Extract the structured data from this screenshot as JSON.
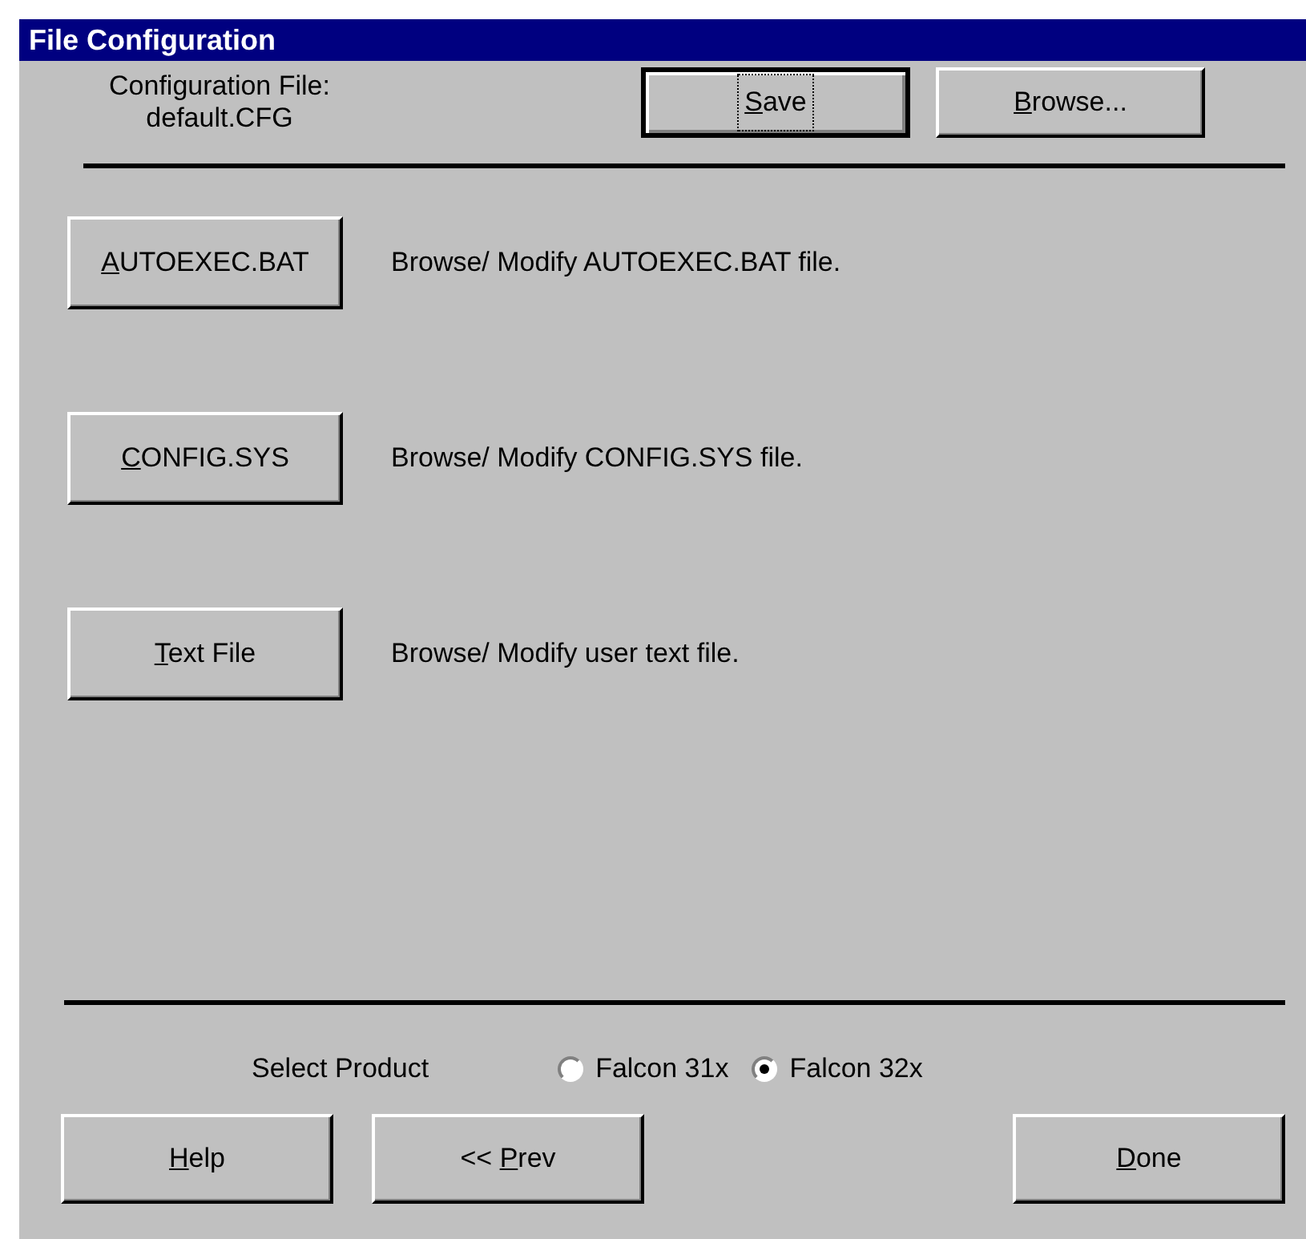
{
  "window": {
    "title": "File Configuration"
  },
  "config_file": {
    "label": "Configuration File:",
    "value": "default.CFG"
  },
  "top_buttons": [
    {
      "key": "S",
      "post": "ave",
      "focused": true
    },
    {
      "key": "B",
      "post": "rowse...",
      "focused": false
    }
  ],
  "file_actions": [
    {
      "button": {
        "key": "A",
        "post": "UTOEXEC.BAT"
      },
      "description": "Browse/ Modify AUTOEXEC.BAT file."
    },
    {
      "button": {
        "key": "C",
        "post": "ONFIG.SYS"
      },
      "description": "Browse/ Modify CONFIG.SYS file."
    },
    {
      "button": {
        "key": "T",
        "post": "ext File"
      },
      "description": "Browse/ Modify user text file."
    }
  ],
  "product": {
    "label": "Select Product",
    "options": [
      {
        "label": "Falcon 31x",
        "selected": false
      },
      {
        "label": "Falcon 32x",
        "selected": true
      }
    ]
  },
  "bottom_buttons": [
    {
      "key": "H",
      "post": "elp"
    },
    {
      "pre": "<< ",
      "key": "P",
      "post": "rev"
    },
    {
      "kind": "spacer"
    },
    {
      "key": "D",
      "post": "one"
    }
  ]
}
